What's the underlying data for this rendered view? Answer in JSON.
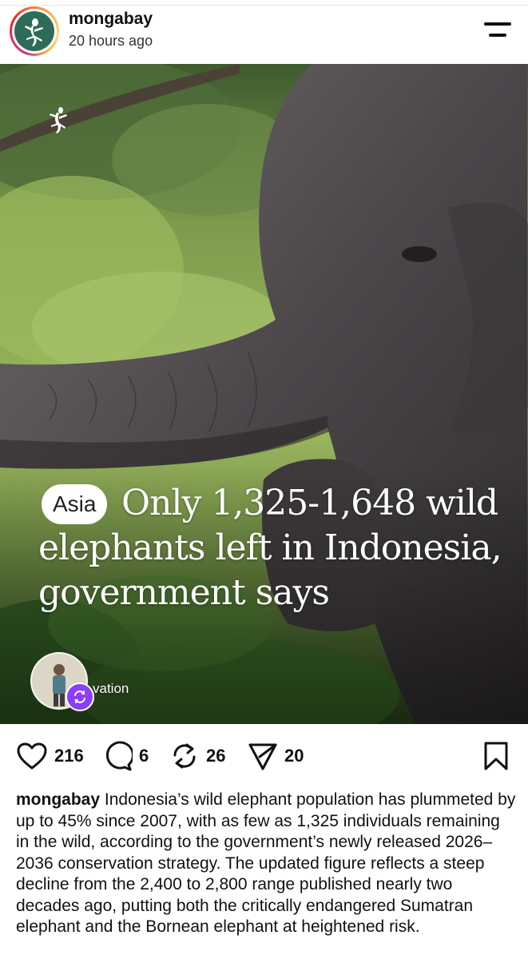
{
  "post": {
    "username": "mongabay",
    "time": "20 hours ago",
    "image": {
      "tag": "Asia",
      "headline": "Only 1,325-1,648 wild elephants left in Indonesia, government says",
      "collab_label": "vation"
    },
    "stats": {
      "likes": "216",
      "comments": "6",
      "reposts": "26",
      "shares": "20"
    },
    "caption": {
      "username": "mongabay",
      "text": "Indonesia’s wild elephant population has plummeted by up to 45% since 2007, with as few as 1,325 individuals remaining in the wild, according to the government’s newly released 2026–2036 conservation strategy. The updated figure reflects a steep decline from the 2,400 to 2,800 range published nearly two decades ago, putting both the critically endangered Sumatran elephant and the Bornean elephant at heightened risk."
    }
  },
  "icons": {
    "avatar": "gecko-logo-icon",
    "menu": "menu-icon",
    "like": "heart-icon",
    "comment": "comment-icon",
    "repost": "repost-icon",
    "share": "send-icon",
    "save": "bookmark-icon"
  },
  "colors": {
    "avatar_bg": "#2f6b59",
    "repost_badge": "#8a3ffc",
    "text": "#111111"
  }
}
